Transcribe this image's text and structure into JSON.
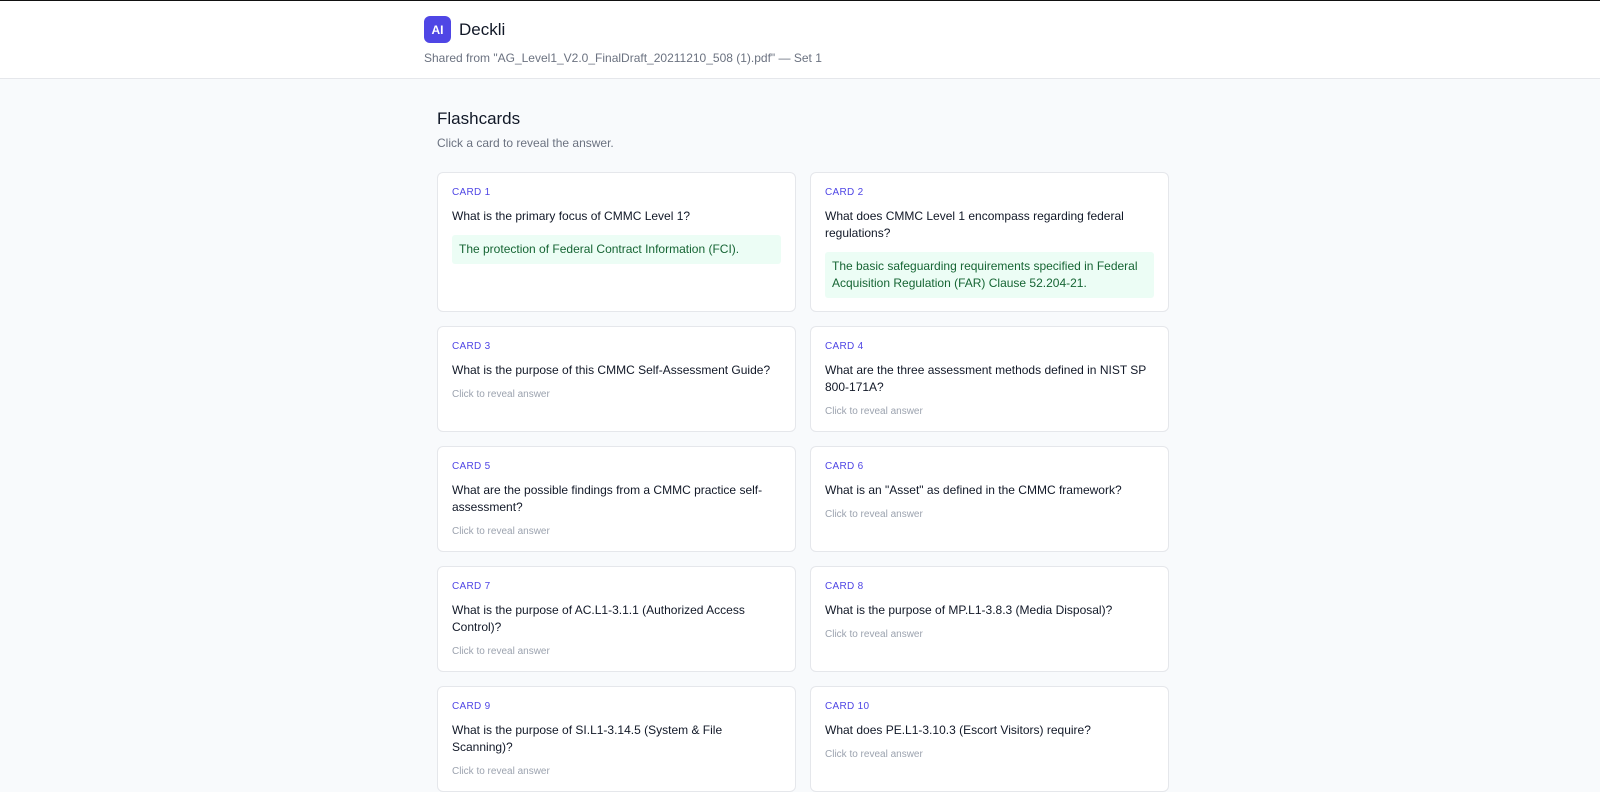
{
  "app": {
    "logo_text": "AI",
    "name": "Deckli",
    "shared_from": "Shared from \"AG_Level1_V2.0_FinalDraft_20211210_508 (1).pdf\" — Set 1"
  },
  "page": {
    "title": "Flashcards",
    "subtitle": "Click a card to reveal the answer."
  },
  "hint_text": "Click to reveal answer",
  "cards": [
    {
      "label": "CARD 1",
      "question": "What is the primary focus of CMMC Level 1?",
      "answer": "The protection of Federal Contract Information (FCI).",
      "revealed": true
    },
    {
      "label": "CARD 2",
      "question": "What does CMMC Level 1 encompass regarding federal regulations?",
      "answer": "The basic safeguarding requirements specified in Federal Acquisition Regulation (FAR) Clause 52.204-21.",
      "revealed": true
    },
    {
      "label": "CARD 3",
      "question": "What is the purpose of this CMMC Self-Assessment Guide?",
      "revealed": false
    },
    {
      "label": "CARD 4",
      "question": "What are the three assessment methods defined in NIST SP 800-171A?",
      "revealed": false
    },
    {
      "label": "CARD 5",
      "question": "What are the possible findings from a CMMC practice self-assessment?",
      "revealed": false
    },
    {
      "label": "CARD 6",
      "question": "What is an \"Asset\" as defined in the CMMC framework?",
      "revealed": false
    },
    {
      "label": "CARD 7",
      "question": "What is the purpose of AC.L1-3.1.1 (Authorized Access Control)?",
      "revealed": false
    },
    {
      "label": "CARD 8",
      "question": "What is the purpose of MP.L1-3.8.3 (Media Disposal)?",
      "revealed": false
    },
    {
      "label": "CARD 9",
      "question": "What is the purpose of SI.L1-3.14.5 (System & File Scanning)?",
      "revealed": false
    },
    {
      "label": "CARD 10",
      "question": "What does PE.L1-3.10.3 (Escort Visitors) require?",
      "revealed": false
    }
  ],
  "colors": {
    "accent": "#4f46e5",
    "answer_bg": "#ecfdf5",
    "answer_text": "#166534"
  }
}
